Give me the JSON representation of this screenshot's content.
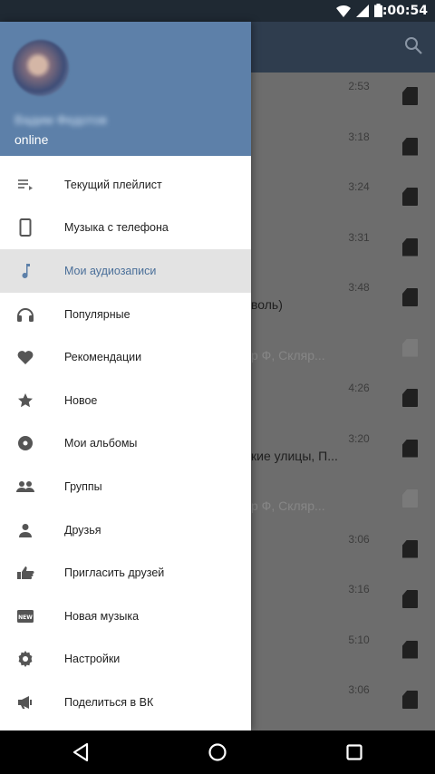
{
  "status_bar": {
    "time": "7:00:54"
  },
  "drawer": {
    "user_status": "online",
    "items": [
      {
        "label": "Текущий плейлист",
        "icon": "playlist-icon"
      },
      {
        "label": "Музыка с телефона",
        "icon": "phone-icon"
      },
      {
        "label": "Мои аудиозаписи",
        "icon": "music-note-icon",
        "active": true
      },
      {
        "label": "Популярные",
        "icon": "headphones-icon"
      },
      {
        "label": "Рекомендации",
        "icon": "heart-icon"
      },
      {
        "label": "Новое",
        "icon": "star-icon"
      },
      {
        "label": "Мои альбомы",
        "icon": "album-icon"
      },
      {
        "label": "Группы",
        "icon": "group-icon"
      },
      {
        "label": "Друзья",
        "icon": "person-icon"
      },
      {
        "label": "Пригласить друзей",
        "icon": "invite-icon"
      },
      {
        "label": "Новая музыка",
        "icon": "new-badge-icon"
      },
      {
        "label": "Настройки",
        "icon": "settings-icon"
      },
      {
        "label": "Поделиться в ВК",
        "icon": "megaphone-icon"
      }
    ]
  },
  "tracks": [
    {
      "duration": "2:53",
      "peek": ""
    },
    {
      "duration": "3:18",
      "peek": ""
    },
    {
      "duration": "3:24",
      "peek": ""
    },
    {
      "duration": "3:31",
      "peek": ""
    },
    {
      "duration": "3:48",
      "peek": "воль)"
    },
    {
      "duration": "",
      "peek": "р Ф, Скляр...",
      "dim": true
    },
    {
      "duration": "4:26",
      "peek": ""
    },
    {
      "duration": "3:20",
      "peek": "кие улицы, П..."
    },
    {
      "duration": "",
      "peek": "р Ф, Скляр...",
      "dim": true
    },
    {
      "duration": "3:06",
      "peek": ""
    },
    {
      "duration": "3:16",
      "peek": ""
    },
    {
      "duration": "5:10",
      "peek": ""
    },
    {
      "duration": "3:06",
      "peek": ""
    }
  ],
  "colors": {
    "drawer_header": "#5d80a9",
    "toolbar": "#2f3d4e",
    "active_label": "#4a6f99"
  }
}
